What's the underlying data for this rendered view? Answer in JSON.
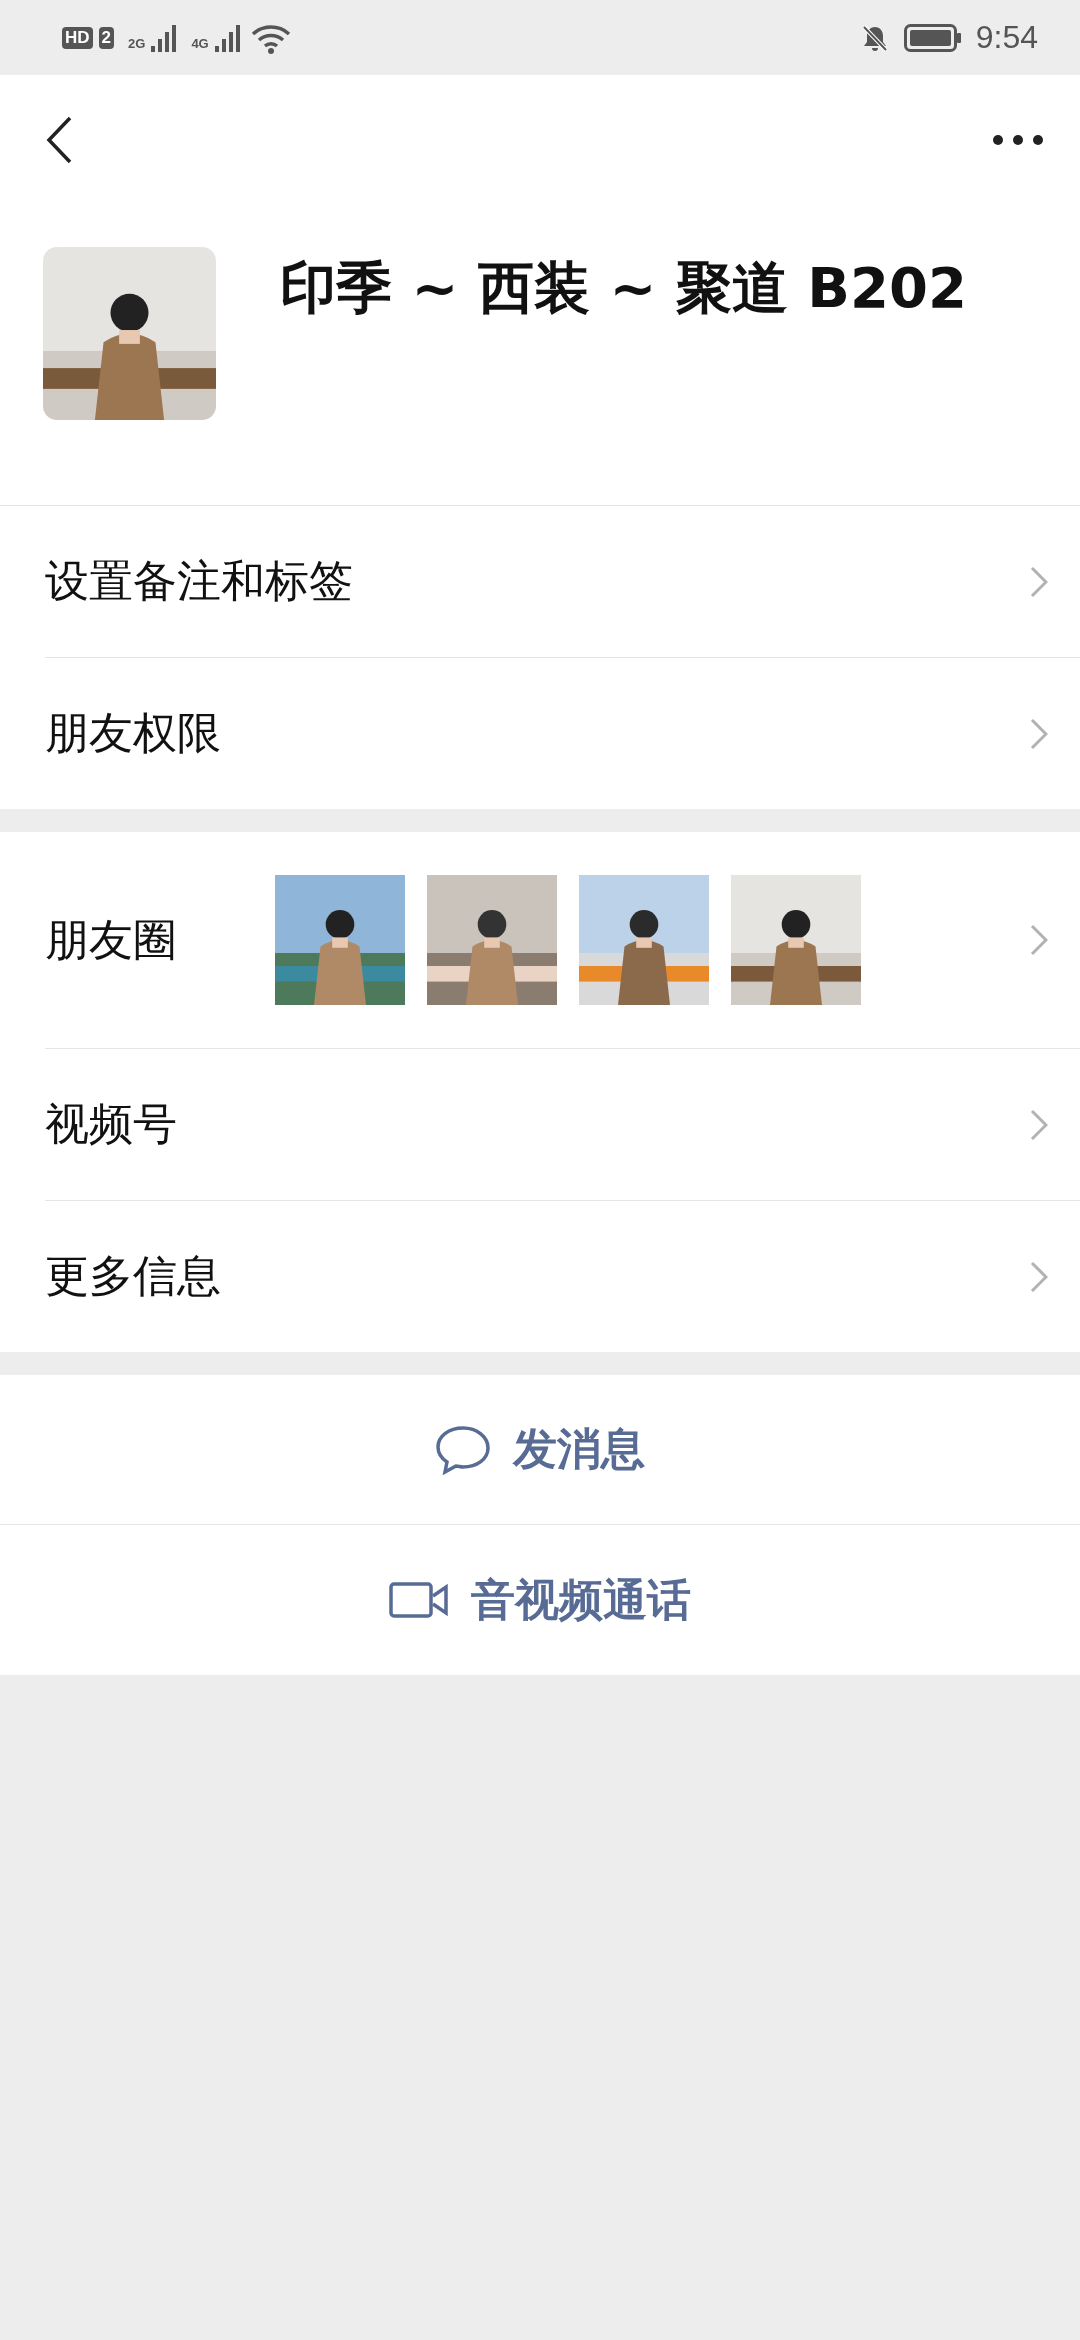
{
  "status_bar": {
    "sim_badges": [
      "HD",
      "2"
    ],
    "networks": [
      "2G",
      "4G"
    ],
    "time": "9:54"
  },
  "profile": {
    "name": "印季 ~ 西装 ~ 聚道 B202"
  },
  "sections": [
    [
      {
        "kind": "plain",
        "label": "设置备注和标签"
      },
      {
        "kind": "plain",
        "label": "朋友权限"
      }
    ],
    [
      {
        "kind": "photos",
        "label": "朋友圈"
      },
      {
        "kind": "plain",
        "label": "视频号"
      },
      {
        "kind": "plain",
        "label": "更多信息"
      }
    ]
  ],
  "actions": [
    {
      "kind": "message",
      "label": "发消息"
    },
    {
      "kind": "call",
      "label": "音视频通话"
    }
  ]
}
